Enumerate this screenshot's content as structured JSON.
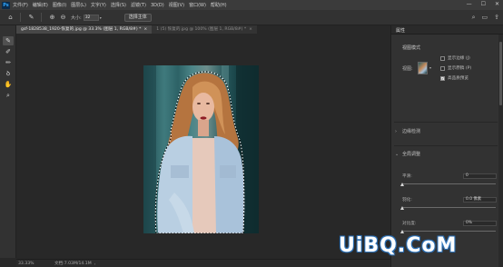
{
  "app": {
    "logo": "Ps"
  },
  "menu": [
    "文件(F)",
    "编辑(E)",
    "图像(I)",
    "图层(L)",
    "文字(Y)",
    "选择(S)",
    "滤镜(T)",
    "3D(D)",
    "视图(V)",
    "窗口(W)",
    "帮助(H)"
  ],
  "window_controls": [
    "—",
    "☐",
    "✕"
  ],
  "options": {
    "size_label": "大小:",
    "size_value": "32",
    "select_subject": "选择主体",
    "icons": [
      "home-icon",
      "brush-preset-icon",
      "add-to-selection-icon",
      "subtract-from-selection-icon",
      "search-icon",
      "workspace-icon",
      "share-icon"
    ]
  },
  "tabs": [
    {
      "label": "gsf-1828538_1920-恢复的.jpg @ 33.3% (图层 1, RGB/8#) *",
      "close": "×",
      "active": true
    },
    {
      "label": "1 (5) 恢复的.jpg @ 100% (图层 1, RGB/8#) *",
      "close": "×",
      "active": false
    }
  ],
  "tools": [
    "quick-selection-tool",
    "refine-edge-brush-tool",
    "brush-tool",
    "lasso-tool",
    "hand-tool",
    "zoom-tool"
  ],
  "status": {
    "zoom": "33.33%",
    "doc": "文档:7.03M/14.1M"
  },
  "panel": {
    "tab_title": "属性",
    "view_mode_title": "视图模式",
    "view_label": "视图:",
    "checkboxes": [
      {
        "label": "显示边缘 (J)",
        "checked": false
      },
      {
        "label": "显示原稿 (P)",
        "checked": false
      },
      {
        "label": "高品质预览",
        "checked": true
      }
    ],
    "edge_detection": "边缘检测",
    "global_refine": "全局调整",
    "sliders": [
      {
        "label": "平滑:",
        "value": "0",
        "fraction": 0.0
      },
      {
        "label": "羽化:",
        "value": "0.0 像素",
        "fraction": 0.0
      },
      {
        "label": "对比度:",
        "value": "0%",
        "fraction": 0.0
      }
    ]
  },
  "watermark": "UiBQ.CoM",
  "colors": {
    "accent": "#31a8ff",
    "panel_bg": "#323232",
    "canvas_bg": "#282828"
  }
}
